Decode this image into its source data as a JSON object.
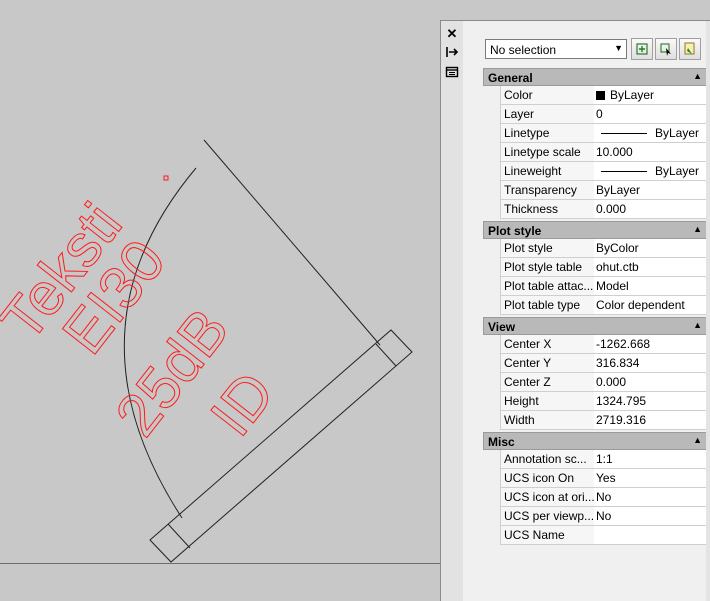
{
  "drawing": {
    "text_lines": [
      "Teksti",
      "EI30",
      "25dB",
      "ID"
    ],
    "text_color": "#ff1a1a",
    "line_color": "#222222"
  },
  "palette": {
    "icons": {
      "close": "close-icon",
      "auto_hide": "auto-hide-icon",
      "properties_menu": "properties-menu-icon"
    },
    "selector": {
      "value": "No selection"
    },
    "toolbar": [
      "toggle-pickadd-icon",
      "select-objects-icon",
      "quick-select-icon"
    ],
    "sections": [
      {
        "title": "General",
        "rows": [
          {
            "name": "Color",
            "value": "ByLayer",
            "kind": "color"
          },
          {
            "name": "Layer",
            "value": "0"
          },
          {
            "name": "Linetype",
            "value": "ByLayer",
            "kind": "line"
          },
          {
            "name": "Linetype scale",
            "value": "10.000"
          },
          {
            "name": "Lineweight",
            "value": "ByLayer",
            "kind": "line"
          },
          {
            "name": "Transparency",
            "value": "ByLayer"
          },
          {
            "name": "Thickness",
            "value": "0.000"
          }
        ]
      },
      {
        "title": "Plot style",
        "rows": [
          {
            "name": "Plot style",
            "value": "ByColor"
          },
          {
            "name": "Plot style table",
            "value": "ohut.ctb"
          },
          {
            "name": "Plot table attac...",
            "value": "Model"
          },
          {
            "name": "Plot table type",
            "value": "Color dependent"
          }
        ]
      },
      {
        "title": "View",
        "rows": [
          {
            "name": "Center X",
            "value": "-1262.668"
          },
          {
            "name": "Center Y",
            "value": "316.834"
          },
          {
            "name": "Center Z",
            "value": "0.000"
          },
          {
            "name": "Height",
            "value": "1324.795"
          },
          {
            "name": "Width",
            "value": "2719.316"
          }
        ]
      },
      {
        "title": "Misc",
        "rows": [
          {
            "name": "Annotation sc...",
            "value": "1:1"
          },
          {
            "name": "UCS icon On",
            "value": "Yes"
          },
          {
            "name": "UCS icon at ori...",
            "value": "No"
          },
          {
            "name": "UCS per viewp...",
            "value": "No"
          },
          {
            "name": "UCS Name",
            "value": ""
          }
        ]
      }
    ]
  }
}
